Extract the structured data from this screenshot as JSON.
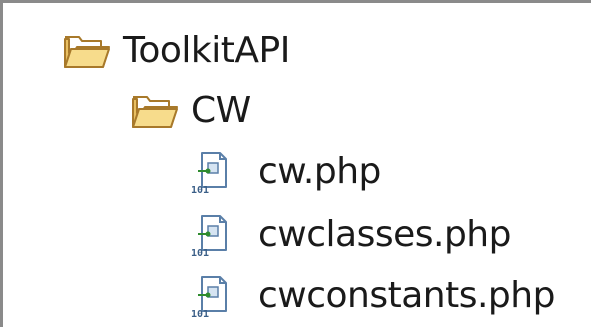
{
  "tree": {
    "root": {
      "label": "ToolkitAPI",
      "icon": "folder-open-icon",
      "children": [
        {
          "label": "CW",
          "icon": "folder-open-icon",
          "children": [
            {
              "label": "cw.php",
              "icon": "php-file-icon"
            },
            {
              "label": "cwclasses.php",
              "icon": "php-file-icon"
            },
            {
              "label": "cwconstants.php",
              "icon": "php-file-icon"
            }
          ]
        }
      ]
    }
  },
  "colors": {
    "folder_fill": "#f3d27a",
    "folder_stroke": "#a8792a",
    "file_fill": "#ffffff",
    "file_stroke": "#5a7fa8",
    "file_accent": "#2e8b2e",
    "border": "#8a8a8a"
  }
}
